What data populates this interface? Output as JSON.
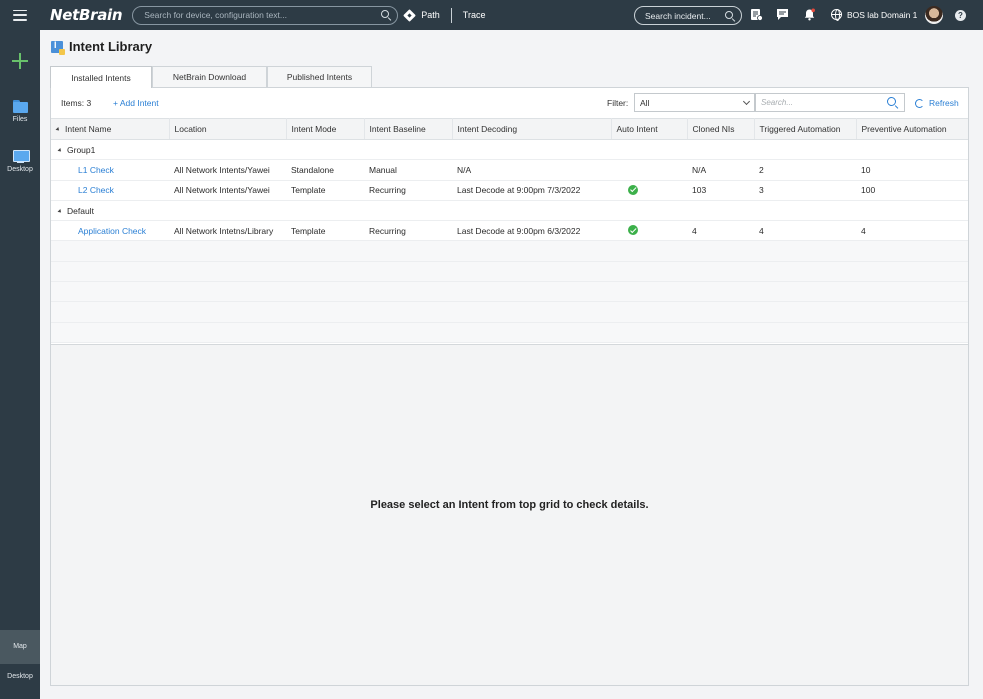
{
  "app": {
    "logo": "NetBrain",
    "search_placeholder": "Search for device, configuration text...",
    "path_label": "Path",
    "trace_label": "Trace",
    "incident_search_placeholder": "Search incident...",
    "domain_label": "BOS lab Domain 1",
    "help_label": "?"
  },
  "sidebar": {
    "files_label": "Files",
    "desktop_label": "Desktop",
    "map_label": "Map",
    "bottom_desktop_label": "Desktop"
  },
  "page": {
    "title": "Intent Library",
    "tabs": [
      {
        "label": "Installed Intents",
        "active": true
      },
      {
        "label": "NetBrain Download",
        "active": false
      },
      {
        "label": "Published Intents",
        "active": false
      }
    ]
  },
  "toolbar": {
    "items_count": "Items: 3",
    "add_intent": "+ Add Intent",
    "filter_label": "Filter:",
    "filter_value": "All",
    "search_placeholder": "Search...",
    "refresh_label": "Refresh"
  },
  "grid": {
    "columns": [
      "Intent Name",
      "Location",
      "Intent Mode",
      "Intent Baseline",
      "Intent Decoding",
      "Auto Intent",
      "Cloned NIs",
      "Triggered Automation",
      "Preventive Automation"
    ],
    "groups": [
      {
        "name": "Group1",
        "rows": [
          {
            "name": "L1 Check",
            "location": "All Network Intents/Yawei",
            "mode": "Standalone",
            "baseline": "Manual",
            "decoding": "N/A",
            "auto_intent": false,
            "cloned": "N/A",
            "triggered": "2",
            "preventive": "10"
          },
          {
            "name": "L2 Check",
            "location": "All Network Intents/Yawei",
            "mode": "Template",
            "baseline": "Recurring",
            "decoding": "Last Decode at 9:00pm 7/3/2022",
            "auto_intent": true,
            "cloned": "103",
            "triggered": "3",
            "preventive": "100"
          }
        ]
      },
      {
        "name": "Default",
        "rows": [
          {
            "name": "Application Check",
            "location": "All Network Intetns/Library",
            "mode": "Template",
            "baseline": "Recurring",
            "decoding": "Last Decode at 9:00pm 6/3/2022",
            "auto_intent": true,
            "cloned": "4",
            "triggered": "4",
            "preventive": "4"
          }
        ]
      }
    ]
  },
  "detail": {
    "message": "Please select an Intent from top grid to check details."
  },
  "colors": {
    "topbar": "#2d3b45",
    "link": "#2a7fd4",
    "success": "#3cb04a",
    "add_green": "#68c16b"
  }
}
